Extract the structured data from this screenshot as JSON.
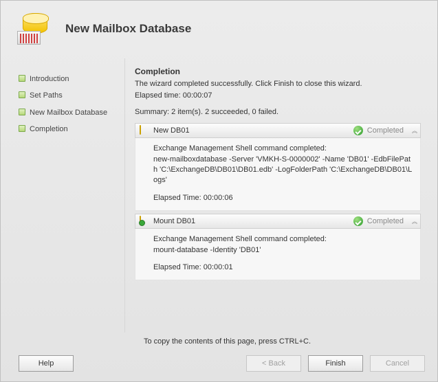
{
  "header": {
    "title": "New Mailbox Database"
  },
  "sidebar": {
    "items": [
      {
        "label": "Introduction"
      },
      {
        "label": "Set Paths"
      },
      {
        "label": "New Mailbox Database"
      },
      {
        "label": "Completion"
      }
    ]
  },
  "main": {
    "section_title": "Completion",
    "description": "The wizard completed successfully. Click Finish to close this wizard.",
    "elapsed_label": "Elapsed time:",
    "elapsed_value": "00:00:07",
    "summary": "Summary: 2 item(s). 2 succeeded, 0 failed.",
    "tasks": [
      {
        "name": "New DB01",
        "status": "Completed",
        "cmd_label": "Exchange Management Shell command completed:",
        "cmd": "new-mailboxdatabase -Server 'VMKH-S-0000002' -Name 'DB01' -EdbFilePath 'C:\\ExchangeDB\\DB01\\DB01.edb' -LogFolderPath 'C:\\ExchangeDB\\DB01\\Logs'",
        "elapsed": "Elapsed Time: 00:00:06"
      },
      {
        "name": "Mount DB01",
        "status": "Completed",
        "cmd_label": "Exchange Management Shell command completed:",
        "cmd": "mount-database -Identity 'DB01'",
        "elapsed": "Elapsed Time: 00:00:01"
      }
    ],
    "copy_hint": "To copy the contents of this page, press CTRL+C."
  },
  "buttons": {
    "help": "Help",
    "back": "< Back",
    "finish": "Finish",
    "cancel": "Cancel"
  }
}
